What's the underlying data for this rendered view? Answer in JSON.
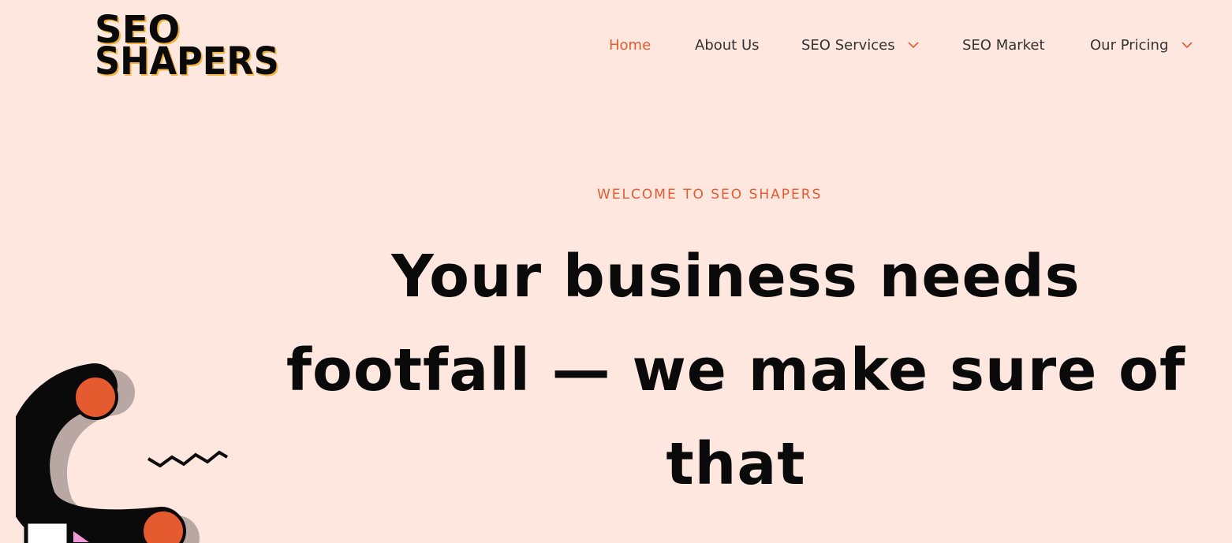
{
  "header": {
    "logo": {
      "line1": "SEO",
      "line2": "SHAPERS"
    },
    "nav": [
      {
        "label": "Home",
        "active": true,
        "has_dropdown": false
      },
      {
        "label": "About Us",
        "active": false,
        "has_dropdown": false
      },
      {
        "label": "SEO Services",
        "active": false,
        "has_dropdown": true
      },
      {
        "label": "SEO Market",
        "active": false,
        "has_dropdown": false
      },
      {
        "label": "Our Pricing",
        "active": false,
        "has_dropdown": true
      }
    ],
    "dropdown_icon": "chevron-down-icon"
  },
  "hero": {
    "eyebrow": "WELCOME TO SEO SHAPERS",
    "headline": "Your business needs footfall — we make sure of that"
  },
  "colors": {
    "background": "#fde7df",
    "accent": "#e55a2f",
    "text": "#0a0a0a",
    "nav_text": "#333333",
    "logo_shadow": "#f2b134",
    "deco_pink": "#f29ad9"
  }
}
